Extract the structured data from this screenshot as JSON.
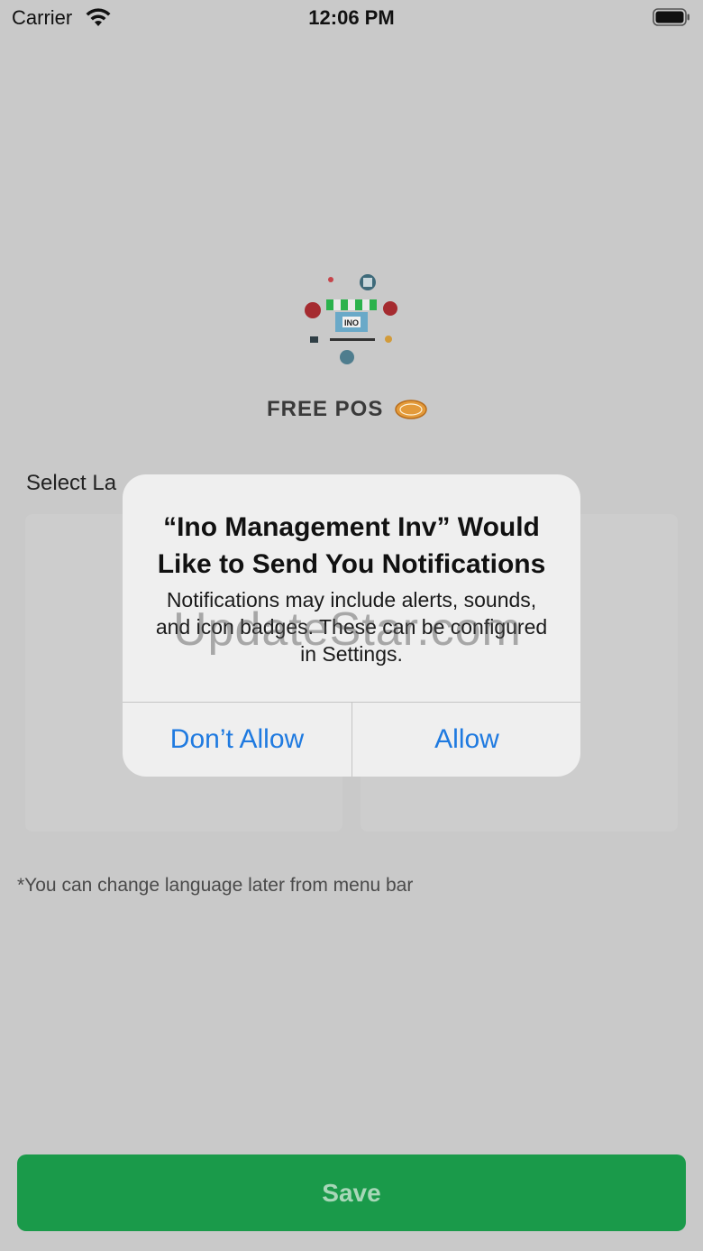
{
  "status_bar": {
    "carrier": "Carrier",
    "time": "12:06 PM",
    "wifi_icon": "wifi-icon",
    "battery_icon": "battery-icon"
  },
  "brand": {
    "name": "FREE POS",
    "logo_icon": "store-logo-icon",
    "logo_text": "INO",
    "badge_icon": "free-badge-icon"
  },
  "language": {
    "section_title": "Select La",
    "footnote": "*You can change language later from menu bar"
  },
  "save_label": "Save",
  "alert": {
    "title": "“Ino Management Inv” Would Like to Send You Notifications",
    "message": "Notifications may include alerts, sounds, and icon badges. These can be configured in Settings.",
    "dont_allow": "Don’t Allow",
    "allow": "Allow"
  },
  "watermark": "UpdateStar.com",
  "colors": {
    "accent_blue": "#1f7ae0",
    "save_green": "#1a9a4a",
    "dim_background": "#c9c9c9"
  }
}
